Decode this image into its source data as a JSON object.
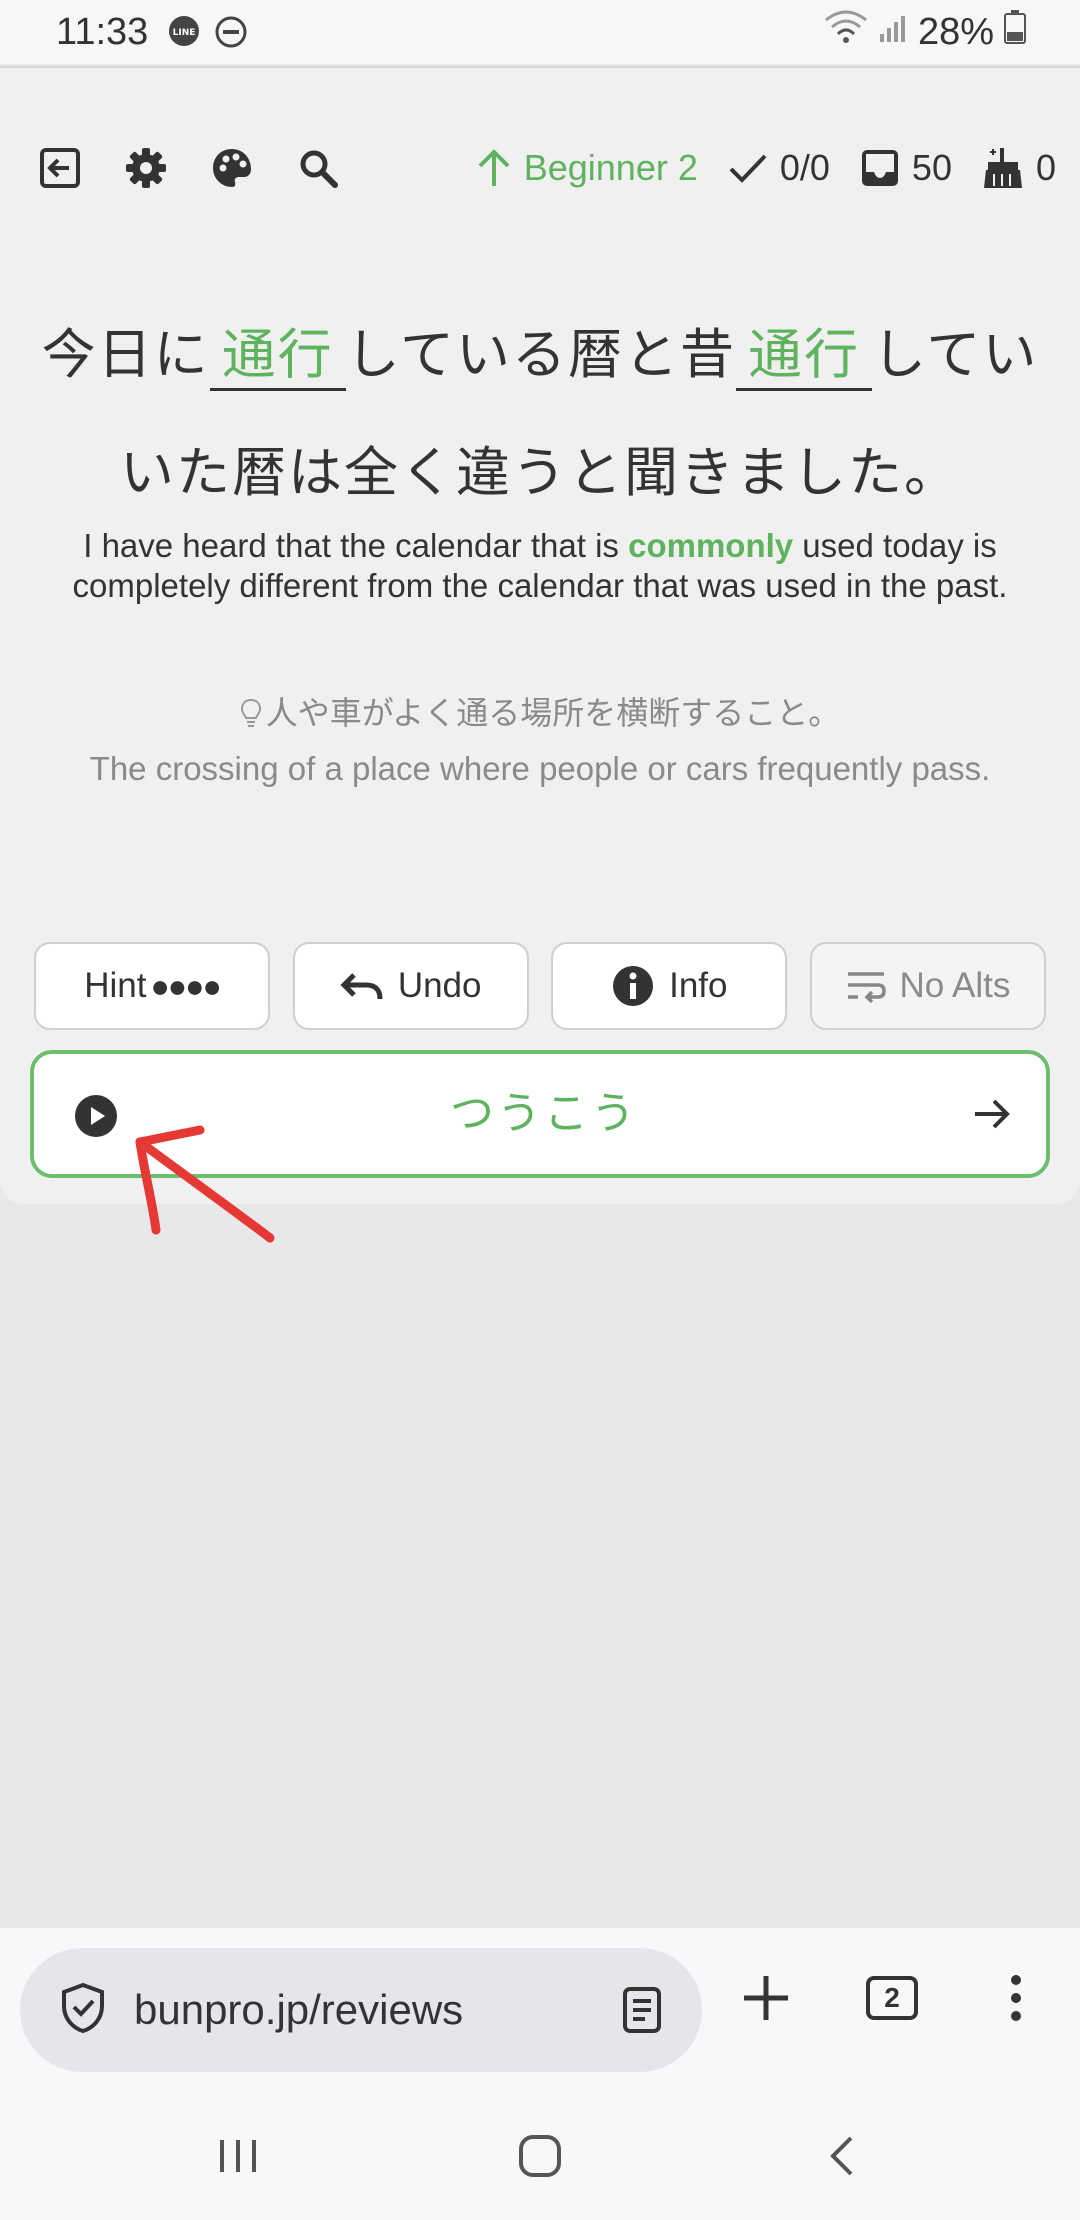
{
  "status_bar": {
    "time": "11:33",
    "battery": "28%",
    "icons": [
      "line-app-icon",
      "do-not-disturb-icon",
      "wifi-icon",
      "signal-icon",
      "battery-icon"
    ]
  },
  "toolbar": {
    "icons": [
      "exit-icon",
      "gear-icon",
      "palette-icon",
      "search-icon"
    ],
    "level": "Beginner 2",
    "correct": "0/0",
    "reviews": "50",
    "ghosts": "0"
  },
  "question": {
    "part1": "今日に",
    "blank1": "通行",
    "part2": "している暦と昔",
    "blank2": "通行",
    "part3": "してい",
    "line2": "いた暦は全く違うと聞きました。"
  },
  "translation": {
    "before": "I have heard that the calendar that is ",
    "highlight": "commonly",
    "after": " used today is completely different from the calendar that was used in the past."
  },
  "hint": {
    "japanese": "人や車がよく通る場所を横断すること。",
    "english": "The crossing of a place where people or cars frequently pass."
  },
  "buttons": {
    "hint": "Hint",
    "hint_dots": "●●●●",
    "undo": "Undo",
    "info": "Info",
    "no_alts": "No Alts"
  },
  "answer": {
    "value": "つうこう"
  },
  "browser": {
    "url": "bunpro.jp/reviews",
    "tab_count": "2"
  },
  "colors": {
    "accent": "#5fb35f",
    "annotation": "#e53935"
  }
}
